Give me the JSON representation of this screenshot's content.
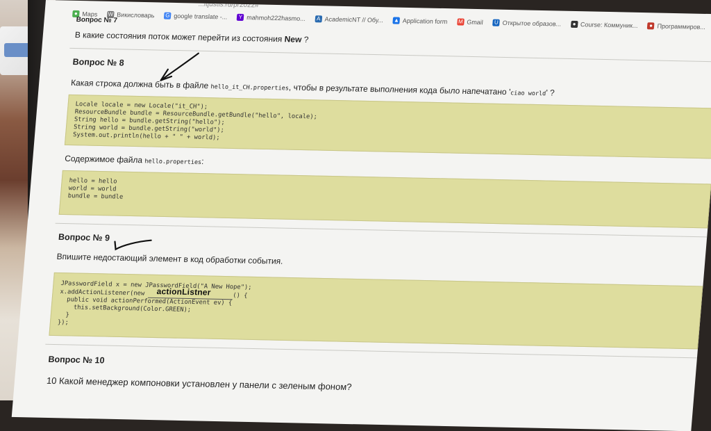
{
  "bookmarks": [
    {
      "label": "Maps",
      "icon": "map-pin-icon",
      "color": "#4caf50"
    },
    {
      "label": "Викисловарь",
      "icon": "wiki-icon",
      "color": "#777777"
    },
    {
      "label": "google translate -...",
      "icon": "google-icon",
      "color": "#4285f4"
    },
    {
      "label": "mahmoh222hasmo...",
      "icon": "yahoo-icon",
      "color": "#6001d2"
    },
    {
      "label": "AcademicNT // Обу...",
      "icon": "academic-icon",
      "color": "#2a6bb0"
    },
    {
      "label": "Application form",
      "icon": "drive-icon",
      "color": "#1a73e8"
    },
    {
      "label": "Gmail",
      "icon": "gmail-icon",
      "color": "#ea4335"
    },
    {
      "label": "Открытое образов...",
      "icon": "openedu-icon",
      "color": "#1565c0"
    },
    {
      "label": "Course: Коммуник...",
      "icon": "course-icon",
      "color": "#333333"
    },
    {
      "label": "Программиров...",
      "icon": "prog-icon",
      "color": "#c0392b"
    }
  ],
  "url_fragment": "...itjustis.ru/pr2022#",
  "prev_question": {
    "heading": "Вопрос № 7",
    "text_before": "В какие состояния поток может перейти из состояния ",
    "text_bold": "New",
    "text_after": " ?"
  },
  "q8": {
    "heading": "Вопрос № 8",
    "text_before": "Какая строка должна быть в файле ",
    "file_code": "hello_it_CH.properties",
    "text_middle": ", чтобы в результате выполнения кода было напечатано '",
    "result_code": "ciao world",
    "text_after": "' ?",
    "code_lines": [
      "Locale locale = new Locale(\"it_CH\");",
      "ResourceBundle bundle = ResourceBundle.getBundle(\"hello\", locale);",
      "String hello = bundle.getString(\"hello\");",
      "String world = bundle.getString(\"world\");",
      "System.out.println(hello + \" \" + world);"
    ],
    "file_label_before": "Содержимое файла ",
    "file_label_code": "hello.properties",
    "file_label_after": ":",
    "file_lines": [
      "hello = hello",
      "world = world",
      "bundle = bundle"
    ]
  },
  "q9": {
    "heading": "Вопрос № 9",
    "text": "Впишите недостающий элемент в код обработки события.",
    "code_line1": "JPasswordField x = new JPasswordField(\"A New Hope\");",
    "code_line2_before": "x.addActionListener(new ",
    "handwritten_answer": "actionListner",
    "code_line2_after": "() {",
    "code_lines_rest": [
      "  public void actionPerformed(ActionEvent ev) {",
      "    this.setBackground(Color.GREEN);",
      "  }",
      "});"
    ]
  },
  "q10": {
    "heading": "Вопрос № 10",
    "text": "10 Какой менеджер компоновки установлен у панели с зеленым фоном?"
  }
}
